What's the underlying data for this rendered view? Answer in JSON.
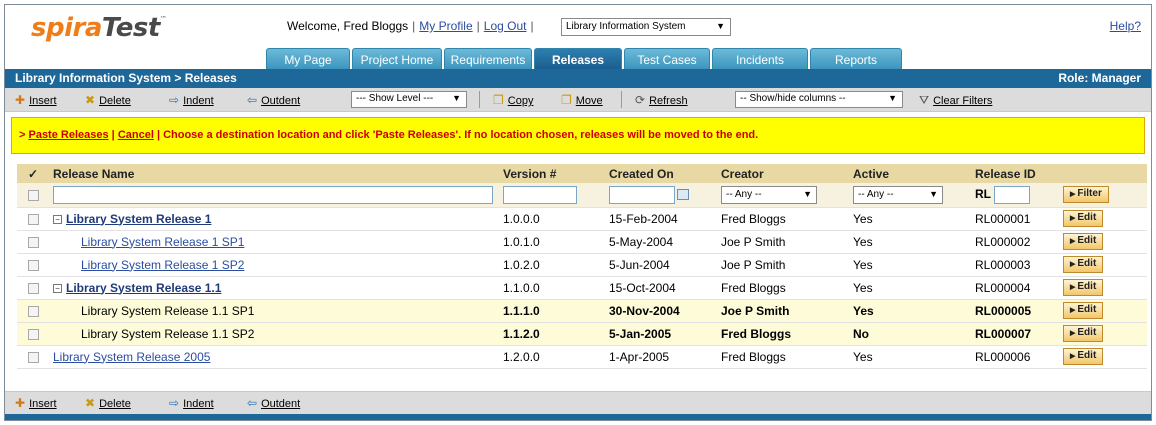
{
  "header": {
    "logo_spira": "spira",
    "logo_test": "Test",
    "logo_tm": "™",
    "welcome": "Welcome, Fred Bloggs",
    "my_profile": "My Profile",
    "log_out": "Log Out",
    "project_select": "Library Information System",
    "help": "Help?"
  },
  "tabs": [
    {
      "label": "My Page",
      "active": false
    },
    {
      "label": "Project Home",
      "active": false
    },
    {
      "label": "Requirements",
      "active": false
    },
    {
      "label": "Releases",
      "active": true
    },
    {
      "label": "Test Cases",
      "active": false
    },
    {
      "label": "Incidents",
      "active": false
    },
    {
      "label": "Reports",
      "active": false
    }
  ],
  "breadcrumb": {
    "path": "Library Information System > Releases",
    "role": "Role: Manager"
  },
  "toolbar": {
    "insert": "Insert",
    "delete": "Delete",
    "indent": "Indent",
    "outdent": "Outdent",
    "show_level": "--- Show Level ---",
    "copy": "Copy",
    "move": "Move",
    "refresh": "Refresh",
    "show_hide_columns": "-- Show/hide columns --",
    "clear_filters": "Clear Filters"
  },
  "message": {
    "prefix": "> ",
    "paste_link": "Paste Releases",
    "sep": " | ",
    "cancel_link": "Cancel",
    "text": " | Choose a destination location and click 'Paste Releases'. If no location chosen, releases will be moved to the end."
  },
  "grid": {
    "columns": {
      "check": "✓",
      "name": "Release Name",
      "version": "Version #",
      "created": "Created On",
      "creator": "Creator",
      "active": "Active",
      "release_id": "Release ID"
    },
    "filter": {
      "creator": "-- Any --",
      "active": "-- Any --",
      "rl_prefix": "RL",
      "filter_button": "Filter"
    },
    "edit_label": "Edit",
    "rows": [
      {
        "name": "Library System Release 1",
        "version": "1.0.0.0",
        "created": "15-Feb-2004",
        "creator": "Fred Bloggs",
        "active": "Yes",
        "id": "RL000001"
      },
      {
        "name": "Library System Release 1 SP1",
        "version": "1.0.1.0",
        "created": "5-May-2004",
        "creator": "Joe P Smith",
        "active": "Yes",
        "id": "RL000002"
      },
      {
        "name": "Library System Release 1 SP2",
        "version": "1.0.2.0",
        "created": "5-Jun-2004",
        "creator": "Joe P Smith",
        "active": "Yes",
        "id": "RL000003"
      },
      {
        "name": "Library System Release 1.1",
        "version": "1.1.0.0",
        "created": "15-Oct-2004",
        "creator": "Fred Bloggs",
        "active": "Yes",
        "id": "RL000004"
      },
      {
        "name": "Library System Release 1.1 SP1",
        "version": "1.1.1.0",
        "created": "30-Nov-2004",
        "creator": "Joe P Smith",
        "active": "Yes",
        "id": "RL000005"
      },
      {
        "name": "Library System Release 1.1 SP2",
        "version": "1.1.2.0",
        "created": "5-Jan-2005",
        "creator": "Fred Bloggs",
        "active": "No",
        "id": "RL000007"
      },
      {
        "name": "Library System Release 2005",
        "version": "1.2.0.0",
        "created": "1-Apr-2005",
        "creator": "Fred Bloggs",
        "active": "Yes",
        "id": "RL000006"
      }
    ]
  },
  "bottom_toolbar": {
    "insert": "Insert",
    "delete": "Delete",
    "indent": "Indent",
    "outdent": "Outdent"
  }
}
